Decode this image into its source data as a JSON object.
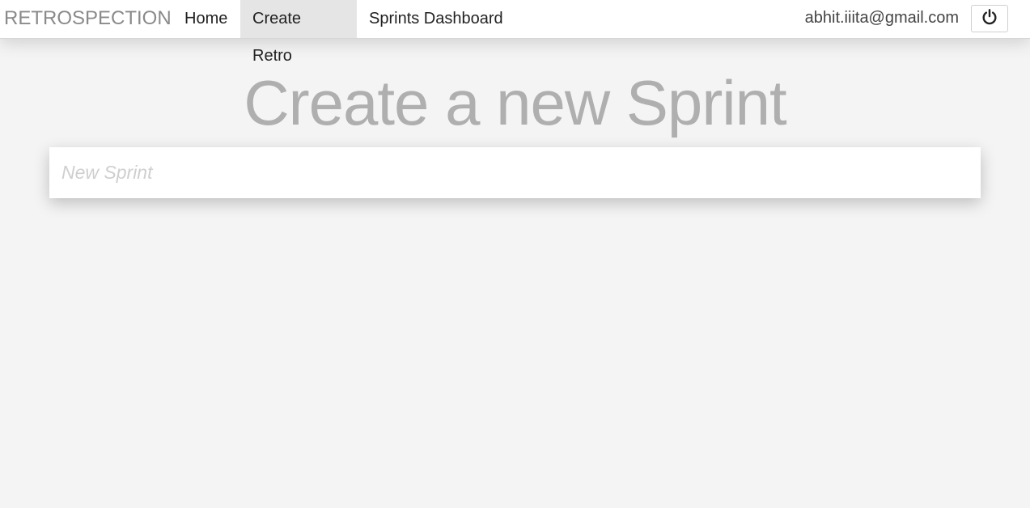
{
  "navbar": {
    "brand": "RETROSPECTION",
    "links": [
      {
        "label": "Home",
        "active": false
      },
      {
        "label": "Create Retro",
        "active": true
      },
      {
        "label": "Sprints Dashboard",
        "active": false
      }
    ],
    "user_email": "abhit.iiita@gmail.com",
    "logout_icon": "power-icon"
  },
  "main": {
    "title": "Create a new Sprint",
    "sprint_input": {
      "placeholder": "New Sprint",
      "value": ""
    }
  },
  "colors": {
    "background": "#f4f4f4",
    "navbar": "#ffffff",
    "active_tab": "#e5e5e5",
    "title_text": "#a8a8a8"
  }
}
